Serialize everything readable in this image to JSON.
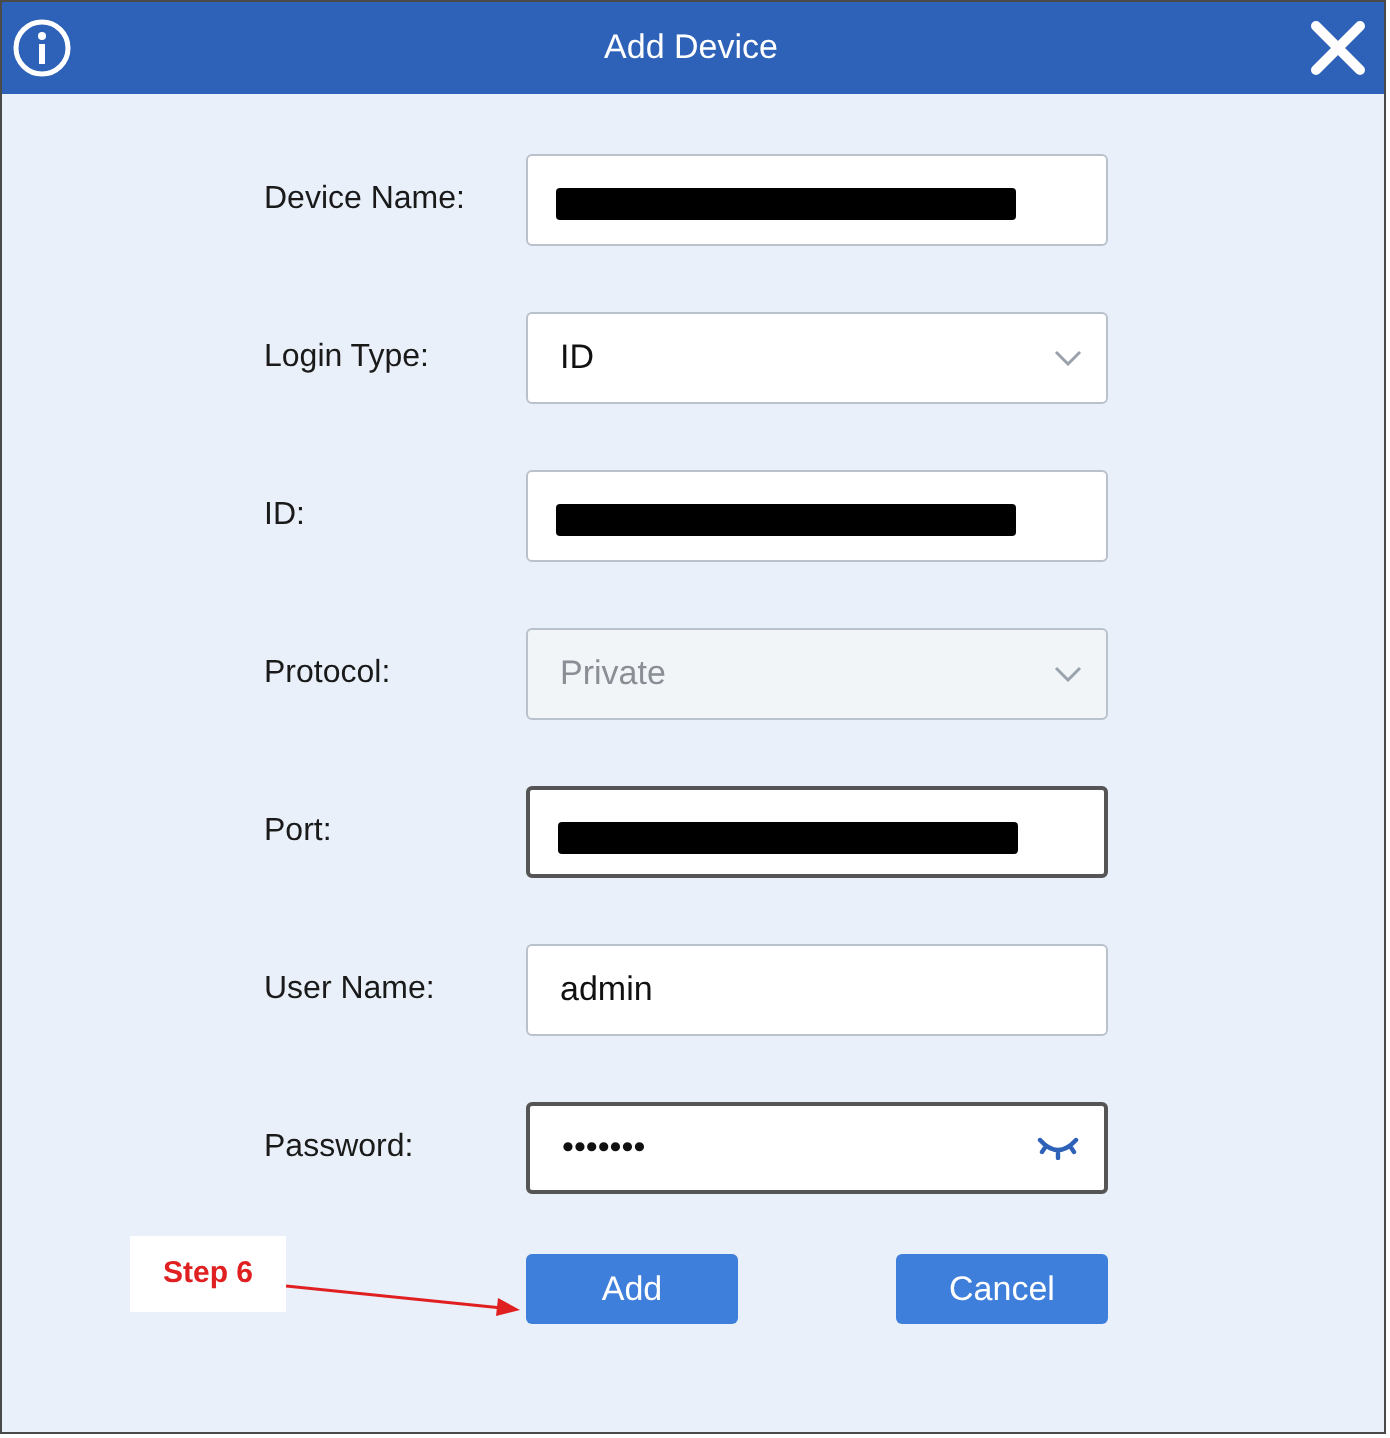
{
  "window": {
    "title": "Add Device"
  },
  "fields": [
    {
      "label": "Device Name:",
      "kind": "text",
      "redacted": true,
      "focused": false,
      "disabled": false
    },
    {
      "label": "Login Type:",
      "kind": "select",
      "value": "ID",
      "redacted": false,
      "focused": false,
      "disabled": false
    },
    {
      "label": "ID:",
      "kind": "text",
      "redacted": true,
      "focused": false,
      "disabled": false
    },
    {
      "label": "Protocol:",
      "kind": "select",
      "value": "Private",
      "redacted": false,
      "focused": false,
      "disabled": true
    },
    {
      "label": "Port:",
      "kind": "text",
      "redacted": true,
      "focused": true,
      "disabled": false
    },
    {
      "label": "User Name:",
      "kind": "text",
      "value": "admin",
      "redacted": false,
      "focused": false,
      "disabled": false
    },
    {
      "label": "Password:",
      "kind": "password",
      "value": "•••••••",
      "redacted": false,
      "focused": true,
      "disabled": false
    }
  ],
  "buttons": [
    "Add",
    "Cancel"
  ],
  "annotation": {
    "text": "Step 6"
  }
}
